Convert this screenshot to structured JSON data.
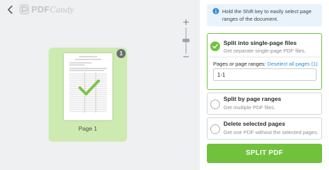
{
  "app": {
    "logo_primary": "PDF",
    "logo_secondary": "Candy",
    "logo_icon": "pdfcandy-logo-icon",
    "back_icon": "chevron-left-icon"
  },
  "viewer": {
    "zoom_in_icon": "plus-icon",
    "zoom_out_icon": "minus-icon",
    "page_card": {
      "label": "Page 1",
      "badge": "1",
      "selected": true
    }
  },
  "sidebar": {
    "tip": {
      "icon": "info-icon",
      "text": "Hold the Shift key to easily select page ranges of the document."
    },
    "options": [
      {
        "title": "Split into single-page files",
        "subtitle": "Get separate single-page PDF files.",
        "selected": true,
        "range_label": "Pages or page ranges:",
        "deselect_link": "Deselect all pages (1)",
        "range_value": "1-1"
      },
      {
        "title": "Split by page ranges",
        "subtitle": "Get multiple PDF files.",
        "selected": false
      },
      {
        "title": "Delete selected pages",
        "subtitle": "Get one PDF without the selected pages.",
        "selected": false
      }
    ],
    "action_button": "SPLIT PDF"
  },
  "colors": {
    "accent_green": "#71c13d",
    "card_green": "#cdeab0",
    "link_blue": "#2f8ad7",
    "tip_bg": "#e9f3fb"
  }
}
